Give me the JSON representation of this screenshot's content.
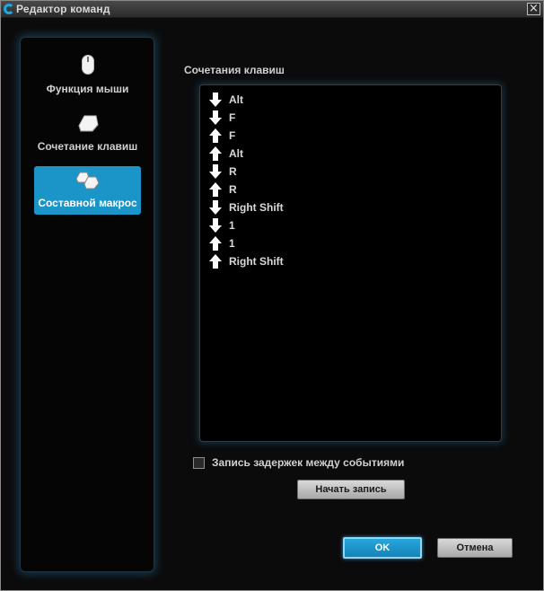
{
  "window": {
    "title": "Редактор команд",
    "close_glyph": "×"
  },
  "sidebar": {
    "items": [
      {
        "label": "Функция мыши",
        "icon": "mouse-icon",
        "active": false
      },
      {
        "label": "Сочетание клавиш",
        "icon": "key-icon",
        "active": false
      },
      {
        "label": "Составной макрос",
        "icon": "multikey-icon",
        "active": true
      }
    ]
  },
  "main": {
    "section_label": "Сочетания клавиш",
    "keys": [
      {
        "direction": "down",
        "label": "Alt"
      },
      {
        "direction": "down",
        "label": "F"
      },
      {
        "direction": "up",
        "label": "F"
      },
      {
        "direction": "up",
        "label": "Alt"
      },
      {
        "direction": "down",
        "label": "R"
      },
      {
        "direction": "up",
        "label": "R"
      },
      {
        "direction": "down",
        "label": "Right Shift"
      },
      {
        "direction": "down",
        "label": "1"
      },
      {
        "direction": "up",
        "label": "1"
      },
      {
        "direction": "up",
        "label": "Right Shift"
      }
    ],
    "record_delays": {
      "label": "Запись задержек между событиями",
      "checked": false
    },
    "record_button": "Начать запись"
  },
  "footer": {
    "ok_label": "OK",
    "cancel_label": "Отмена"
  },
  "colors": {
    "accent": "#1b94c8",
    "glow": "#2878aa"
  }
}
